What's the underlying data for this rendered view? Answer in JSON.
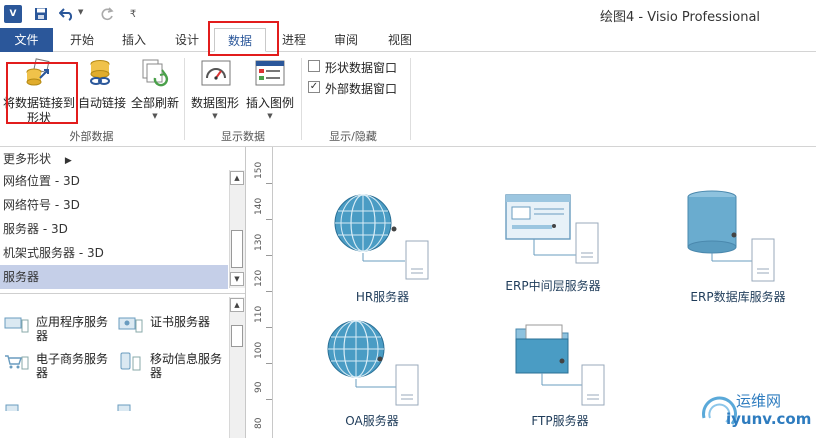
{
  "window": {
    "title": "绘图4 - Visio Professional",
    "app_logo": "V"
  },
  "quick_access": {
    "save_icon": "save-icon",
    "undo_icon": "undo-icon",
    "redo_icon": "redo-icon",
    "customize_icon": "customize-icon"
  },
  "tabs": [
    {
      "label": "文件"
    },
    {
      "label": "开始"
    },
    {
      "label": "插入"
    },
    {
      "label": "设计"
    },
    {
      "label": "数据"
    },
    {
      "label": "进程"
    },
    {
      "label": "审阅"
    },
    {
      "label": "视图"
    }
  ],
  "ribbon": {
    "groups": [
      {
        "label": "外部数据"
      },
      {
        "label": "显示数据"
      },
      {
        "label": "显示/隐藏"
      }
    ],
    "buttons": {
      "link_data_line1": "将数据链接到",
      "link_data_line2": "形状",
      "auto_link": "自动链接",
      "refresh_all": "全部刷新",
      "data_graphics": "数据图形",
      "insert_legend": "插入图例"
    },
    "checkboxes": [
      {
        "label": "形状数据窗口",
        "checked": false
      },
      {
        "label": "外部数据窗口",
        "checked": true
      }
    ]
  },
  "shapes_pane": {
    "more_shapes": "更多形状",
    "stencils": [
      {
        "label": "网络位置 - 3D"
      },
      {
        "label": "网络符号 - 3D"
      },
      {
        "label": "服务器 - 3D"
      },
      {
        "label": "机架式服务器 - 3D"
      },
      {
        "label": "服务器"
      }
    ],
    "shapes": [
      {
        "label_line1": "应用程序服务",
        "label_line2": "器"
      },
      {
        "label_line1": "证书服务器",
        "label_line2": ""
      },
      {
        "label_line1": "电子商务服务",
        "label_line2": "器"
      },
      {
        "label_line1": "移动信息服务",
        "label_line2": "器"
      }
    ]
  },
  "ruler": {
    "labels": [
      "150",
      "140",
      "130",
      "120",
      "110",
      "100",
      "90",
      "80"
    ]
  },
  "canvas": {
    "shapes": [
      {
        "caption": "HR服务器"
      },
      {
        "caption": "ERP中间层服务器"
      },
      {
        "caption": "ERP数据库服务器"
      },
      {
        "caption": "OA服务器"
      },
      {
        "caption": "FTP服务器"
      }
    ]
  },
  "watermark": {
    "line1": "运维网",
    "line2": "iyunv.com"
  },
  "colors": {
    "accent": "#2b579a",
    "highlight_red": "#e21c1c",
    "selected_stencil": "#c5cfe8",
    "globe": "#4a9cc4"
  }
}
